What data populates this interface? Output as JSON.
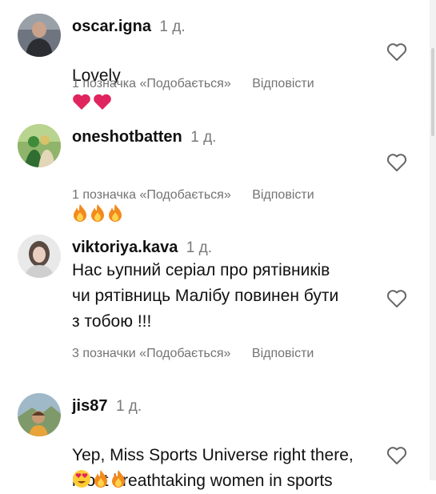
{
  "comments": [
    {
      "username": "oscar.igna",
      "time": "1 д.",
      "text": "Lovely",
      "emojis": [
        "red-heart",
        "red-heart"
      ],
      "likes_label": "1 позначка «Подобається»",
      "reply_label": "Відповісти"
    },
    {
      "username": "oneshotbatten",
      "time": "1 д.",
      "text": "",
      "emojis": [
        "fire",
        "fire",
        "fire"
      ],
      "likes_label": "1 позначка «Подобається»",
      "reply_label": "Відповісти"
    },
    {
      "username": "viktoriya.kava",
      "time": "1 д.",
      "text": "Нас ьупний серіал про рятівників\nчи рятівниць Малібу повинен бути\nз тобою !!!",
      "emojis": [],
      "likes_label": "3 позначки «Подобається»",
      "reply_label": "Відповісти"
    },
    {
      "username": "jis87",
      "time": "1 д.",
      "text": "Yep, Miss Sports Universe right there,\nmost breathtaking women in sports",
      "emojis": [
        "heart-eyes",
        "fire",
        "fire"
      ],
      "likes_label": "",
      "reply_label": ""
    }
  ],
  "icons": {
    "like": "heart-outline-icon"
  },
  "colors": {
    "secondary_text": "#737373",
    "heart_red": "#e0245e"
  }
}
